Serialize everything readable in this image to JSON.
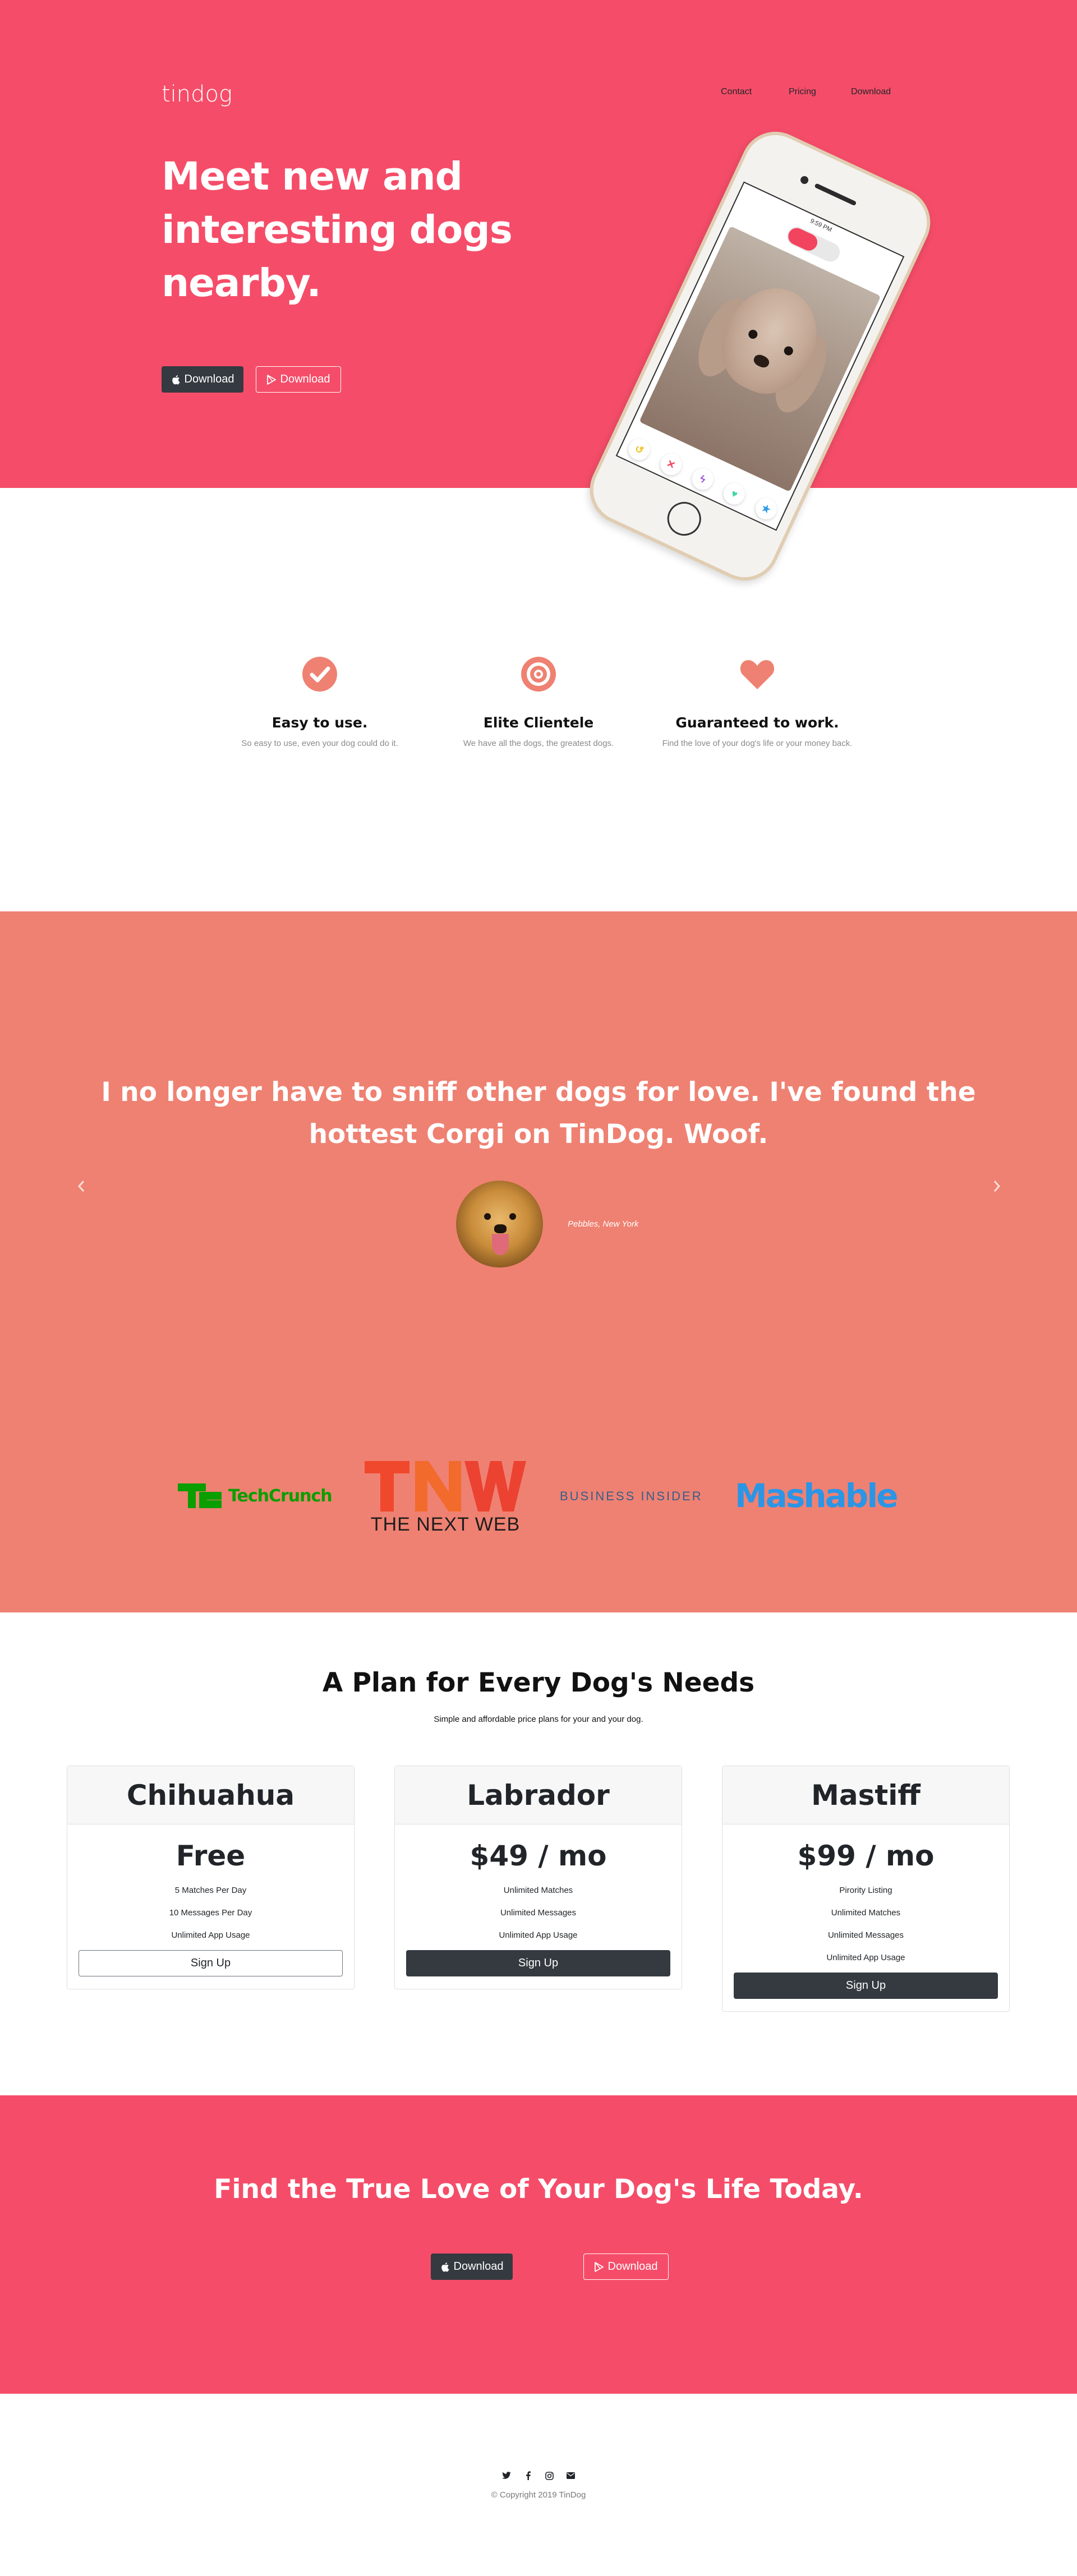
{
  "colors": {
    "hero_bg": "#f54d69",
    "testimonial_bg": "#ef8172",
    "accent": "#ef8172",
    "dark_button": "#343a40"
  },
  "header": {
    "brand": "tindog",
    "nav": [
      "Contact",
      "Pricing",
      "Download"
    ]
  },
  "hero": {
    "title": "Meet new and interesting dogs nearby.",
    "buttons": [
      {
        "label": "Download",
        "icon": "apple-icon"
      },
      {
        "label": "Download",
        "icon": "google-play-icon"
      }
    ],
    "phone": {
      "status_time": "9:59 PM",
      "actions": [
        "undo-icon",
        "nope-icon",
        "boost-icon",
        "like-icon",
        "super-like-icon"
      ]
    }
  },
  "features": [
    {
      "icon": "check-circle-icon",
      "title": "Easy to use.",
      "text": "So easy to use, even your dog could do it."
    },
    {
      "icon": "bullseye-icon",
      "title": "Elite Clientele",
      "text": "We have all the dogs, the greatest dogs."
    },
    {
      "icon": "heart-icon",
      "title": "Guaranteed to work.",
      "text": "Find the love of your dog's life or your money back."
    }
  ],
  "testimonial": {
    "quote": "I no longer have to sniff other dogs for love. I've found the hottest Corgi on TinDog. Woof.",
    "attribution": "Pebbles, New York"
  },
  "press": [
    "TechCrunch",
    "THE NEXT WEB",
    "BUSINESS INSIDER",
    "Mashable"
  ],
  "pricing": {
    "title": "A Plan for Every Dog's Needs",
    "subtitle": "Simple and affordable price plans for your and your dog.",
    "plans": [
      {
        "name": "Chihuahua",
        "price": "Free",
        "features": [
          "5 Matches Per Day",
          "10 Messages Per Day",
          "Unlimited App Usage"
        ],
        "cta": "Sign Up"
      },
      {
        "name": "Labrador",
        "price": "$49 / mo",
        "features": [
          "Unlimited Matches",
          "Unlimited Messages",
          "Unlimited App Usage"
        ],
        "cta": "Sign Up"
      },
      {
        "name": "Mastiff",
        "price": "$99 / mo",
        "features": [
          "Pirority Listing",
          "Unlimited Matches",
          "Unlimited Messages",
          "Unlimited App Usage"
        ],
        "cta": "Sign Up"
      }
    ]
  },
  "cta": {
    "title": "Find the True Love of Your Dog's Life Today.",
    "buttons": [
      {
        "label": "Download",
        "icon": "apple-icon"
      },
      {
        "label": "Download",
        "icon": "google-play-icon"
      }
    ]
  },
  "footer": {
    "icons": [
      "twitter-icon",
      "facebook-icon",
      "instagram-icon",
      "envelope-icon"
    ],
    "copyright": "© Copyright 2019 TinDog"
  }
}
